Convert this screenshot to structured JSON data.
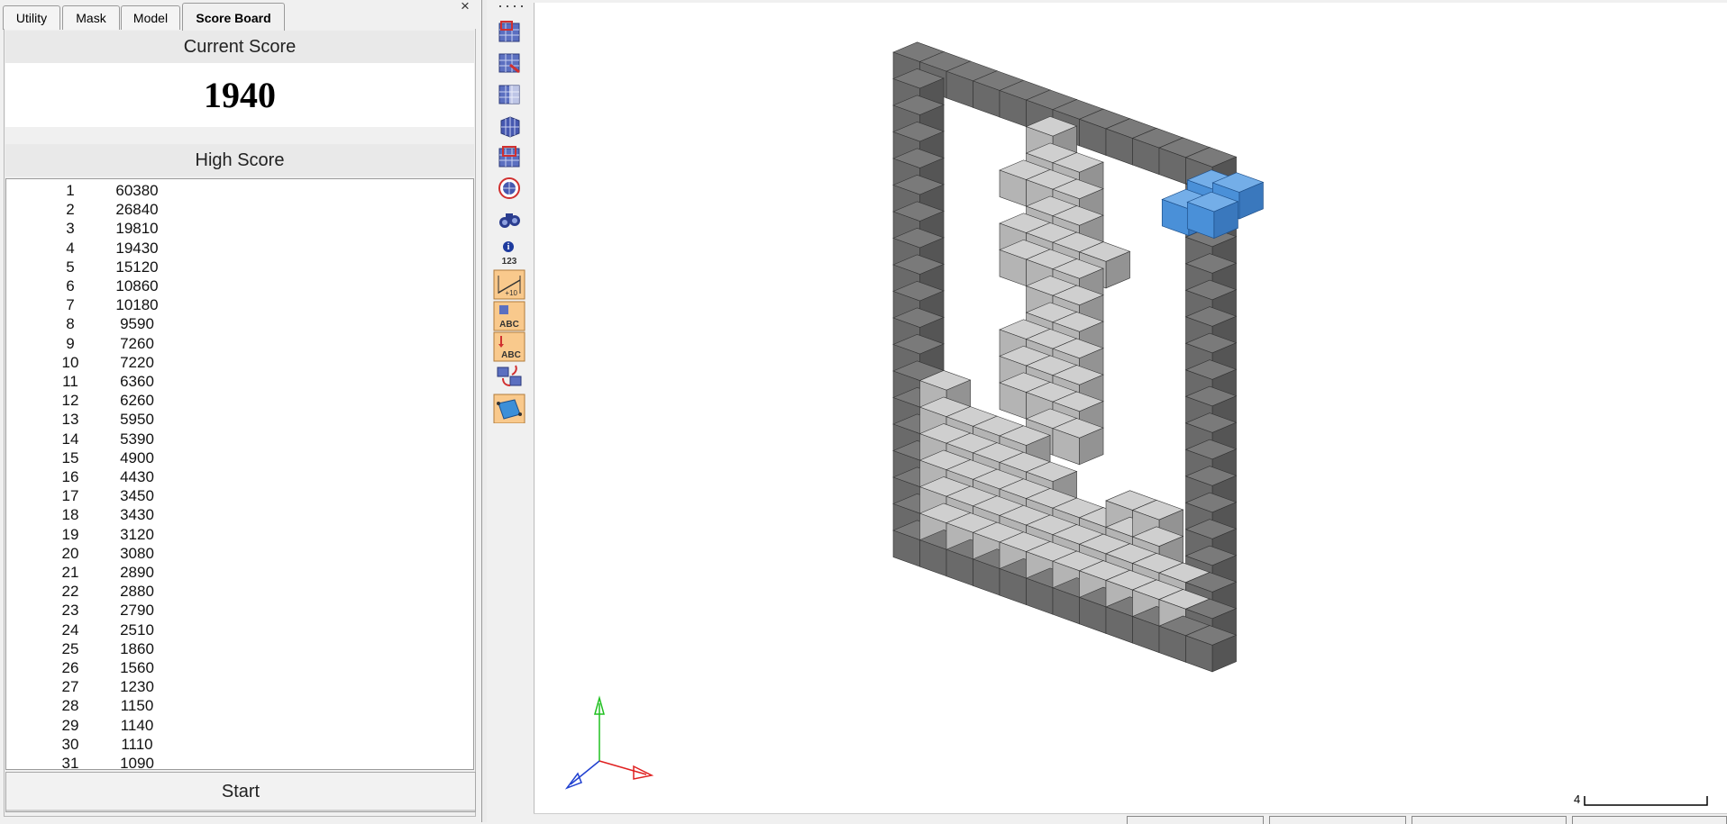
{
  "tabs": [
    {
      "label": "Utility",
      "active": false
    },
    {
      "label": "Mask",
      "active": false
    },
    {
      "label": "Model",
      "active": false
    },
    {
      "label": "Score Board",
      "active": true
    }
  ],
  "close_glyph": "×",
  "score_board": {
    "current_score_label": "Current Score",
    "current_score": "1940",
    "high_score_label": "High Score",
    "high_scores": [
      {
        "rank": "1",
        "score": "60380"
      },
      {
        "rank": "2",
        "score": "26840"
      },
      {
        "rank": "3",
        "score": "19810"
      },
      {
        "rank": "4",
        "score": "19430"
      },
      {
        "rank": "5",
        "score": "15120"
      },
      {
        "rank": "6",
        "score": "10860"
      },
      {
        "rank": "7",
        "score": "10180"
      },
      {
        "rank": "8",
        "score": "9590"
      },
      {
        "rank": "9",
        "score": "7260"
      },
      {
        "rank": "10",
        "score": "7220"
      },
      {
        "rank": "11",
        "score": "6360"
      },
      {
        "rank": "12",
        "score": "6260"
      },
      {
        "rank": "13",
        "score": "5950"
      },
      {
        "rank": "14",
        "score": "5390"
      },
      {
        "rank": "15",
        "score": "4900"
      },
      {
        "rank": "16",
        "score": "4430"
      },
      {
        "rank": "17",
        "score": "3450"
      },
      {
        "rank": "18",
        "score": "3430"
      },
      {
        "rank": "19",
        "score": "3120"
      },
      {
        "rank": "20",
        "score": "3080"
      },
      {
        "rank": "21",
        "score": "2890"
      },
      {
        "rank": "22",
        "score": "2880"
      },
      {
        "rank": "23",
        "score": "2790"
      },
      {
        "rank": "24",
        "score": "2510"
      },
      {
        "rank": "25",
        "score": "1860"
      },
      {
        "rank": "26",
        "score": "1560"
      },
      {
        "rank": "27",
        "score": "1230"
      },
      {
        "rank": "28",
        "score": "1150"
      },
      {
        "rank": "29",
        "score": "1140"
      },
      {
        "rank": "30",
        "score": "1110"
      },
      {
        "rank": "31",
        "score": "1090"
      }
    ],
    "start_label": "Start"
  },
  "toolbar": {
    "icons": [
      "mesh-select-icon",
      "mesh-edit-icon",
      "mesh-split-icon",
      "mesh-grid-icon",
      "mesh-layer-icon",
      "sphere-mesh-icon",
      "binoculars-icon",
      "info-123-icon",
      "measure-icon",
      "label-abc-icon",
      "label-move-icon",
      "transform-icon",
      "surface-icon"
    ],
    "info_text": "123",
    "abc_text": "ABC"
  },
  "viewport": {
    "scale_value": "4",
    "colors": {
      "wall_top": "#7a7a7a",
      "wall_front": "#6a6a6a",
      "wall_side": "#555555",
      "block_front": "#b4b4b4",
      "block_top": "#cfcfcf",
      "block_side": "#939393",
      "piece_front": "#4a90d8",
      "piece_top": "#74aee8",
      "piece_side": "#3a78bd",
      "axis_x": "#e02020",
      "axis_y": "#20c020",
      "axis_z": "#2040d0"
    }
  }
}
